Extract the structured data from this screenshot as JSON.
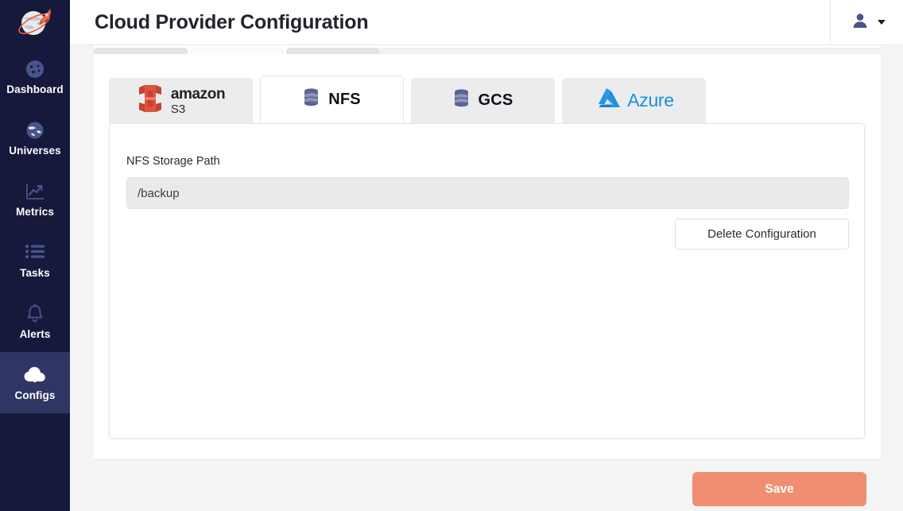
{
  "app": {
    "logo_icon": "globe-rocket-logo",
    "accent_color": "#ef8e71",
    "sidebar_color": "#16193b",
    "sidebar_active_color": "#2f3664"
  },
  "sidebar": {
    "items": [
      {
        "label": "Dashboard",
        "icon": "dashboard-gauge-icon",
        "active": false
      },
      {
        "label": "Universes",
        "icon": "globe-icon",
        "active": false
      },
      {
        "label": "Metrics",
        "icon": "chart-line-icon",
        "active": false
      },
      {
        "label": "Tasks",
        "icon": "list-icon",
        "active": false
      },
      {
        "label": "Alerts",
        "icon": "bell-icon",
        "active": false
      },
      {
        "label": "Configs",
        "icon": "cloud-upload-icon",
        "active": true
      }
    ]
  },
  "header": {
    "title": "Cloud Provider Configuration",
    "user_icon": "user-avatar-icon",
    "caret_icon": "chevron-down-icon"
  },
  "provider_tabs": [
    {
      "id": "s3",
      "label": "amazon S3",
      "amazon": "amazon",
      "s3": "S3",
      "icon": "amazon-s3-logo",
      "active": false
    },
    {
      "id": "nfs",
      "label": "NFS",
      "icon": "database-icon",
      "active": true
    },
    {
      "id": "gcs",
      "label": "GCS",
      "icon": "database-icon",
      "active": false
    },
    {
      "id": "azure",
      "label": "Azure",
      "icon": "azure-logo",
      "active": false
    }
  ],
  "form": {
    "storage_path_label": "NFS Storage Path",
    "storage_path_value": "/backup",
    "storage_path_placeholder": "/backup",
    "delete_label": "Delete Configuration"
  },
  "footer": {
    "save_label": "Save"
  }
}
